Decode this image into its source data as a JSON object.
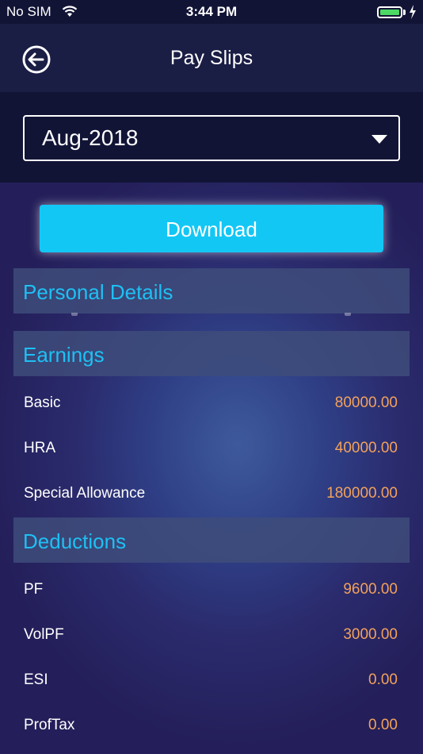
{
  "status_bar": {
    "carrier": "No SIM",
    "time": "3:44 PM"
  },
  "nav": {
    "title": "Pay Slips",
    "back_icon": "back-arrow-circle-icon"
  },
  "period_select": {
    "value": "Aug-2018",
    "caret_icon": "chevron-down-icon"
  },
  "download_label": "Download",
  "sections": {
    "personal": {
      "title": "Personal Details"
    },
    "earnings": {
      "title": "Earnings",
      "rows": [
        {
          "label": "Basic",
          "value": "80000.00"
        },
        {
          "label": "HRA",
          "value": "40000.00"
        },
        {
          "label": "Special Allowance",
          "value": "180000.00"
        }
      ]
    },
    "deductions": {
      "title": "Deductions",
      "rows": [
        {
          "label": "PF",
          "value": "9600.00"
        },
        {
          "label": "VolPF",
          "value": "3000.00"
        },
        {
          "label": "ESI",
          "value": "0.00"
        },
        {
          "label": "ProfTax",
          "value": "0.00"
        }
      ]
    }
  },
  "colors": {
    "accent": "#1ec0f3",
    "button": "#13c7f5",
    "value": "#f2a25c",
    "battery": "#4cd964"
  }
}
